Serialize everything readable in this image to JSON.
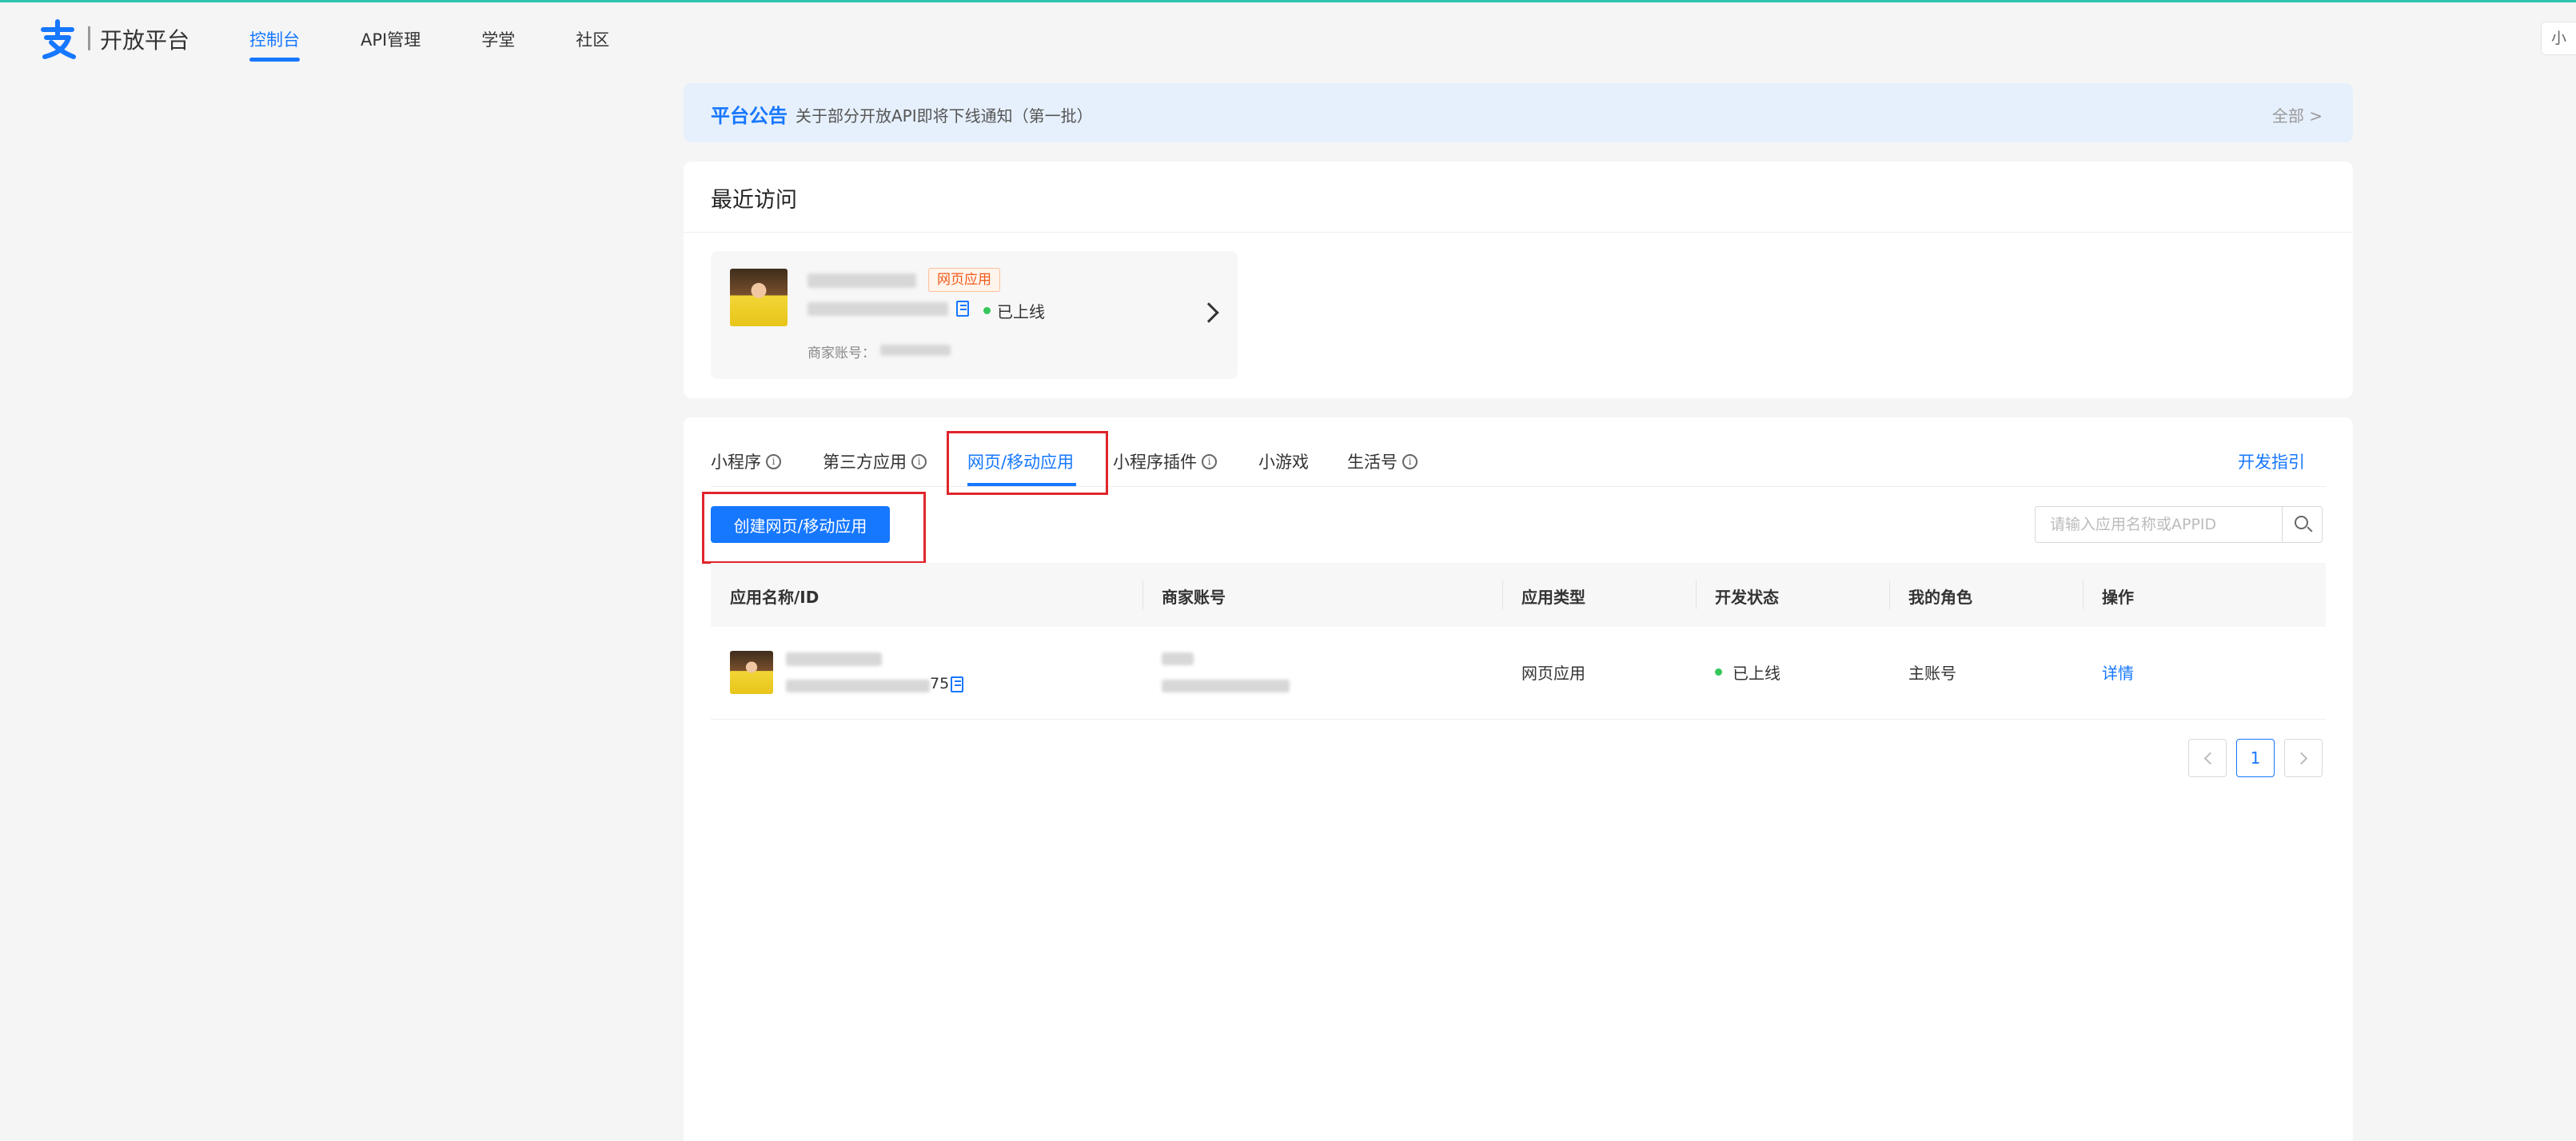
{
  "header": {
    "brand": "开放平台",
    "nav": [
      "控制台",
      "API管理",
      "学堂",
      "社区"
    ],
    "user_label": "小"
  },
  "notice": {
    "title": "平台公告",
    "text": "关于部分开放API即将下线通知（第一批）",
    "all_link": "全部 >"
  },
  "recent": {
    "title": "最近访问",
    "card": {
      "tag": "网页应用",
      "status": "已上线",
      "merchant_label": "商家账号："
    }
  },
  "tabs": {
    "items": [
      "小程序",
      "第三方应用",
      "网页/移动应用",
      "小程序插件",
      "小游戏",
      "生活号"
    ],
    "active_index": 2,
    "dev_guide": "开发指引"
  },
  "toolbar": {
    "create_label": "创建网页/移动应用",
    "search_placeholder": "请输入应用名称或APPID"
  },
  "table": {
    "headers": [
      "应用名称/ID",
      "商家账号",
      "应用类型",
      "开发状态",
      "我的角色",
      "操作"
    ],
    "rows": [
      {
        "id_suffix": "75",
        "type": "网页应用",
        "status": "已上线",
        "role": "主账号",
        "action": "详情"
      }
    ]
  },
  "pagination": {
    "current": "1"
  },
  "colors": {
    "primary": "#1677ff",
    "annotation": "#e0252b",
    "online": "#35c759"
  }
}
